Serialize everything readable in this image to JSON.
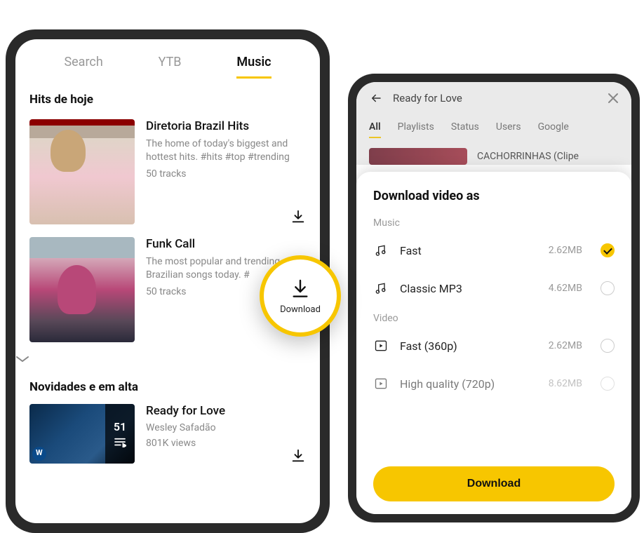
{
  "phone1": {
    "tabs": {
      "search": "Search",
      "ytb": "YTB",
      "music": "Music"
    },
    "section1_title": "Hits de hoje",
    "items": [
      {
        "title": "Diretoria Brazil Hits",
        "desc": "The home of today's biggest and hottest hits. #hits #top #trending",
        "meta": "50 tracks"
      },
      {
        "title": "Funk Call",
        "desc": "The most popular and trending Brazilian songs today. #",
        "meta": "50 tracks"
      }
    ],
    "section2_title": "Novidades e em alta",
    "item3": {
      "title": "Ready for Love",
      "artist": "Wesley Safadão",
      "views": "801K views",
      "badge_count": "51"
    }
  },
  "callout": {
    "label": "Download"
  },
  "phone2": {
    "search_query": "Ready for Love",
    "filters": {
      "all": "All",
      "playlists": "Playlists",
      "status": "Status",
      "users": "Users",
      "google": "Google"
    },
    "result_title": "CACHORRINHAS (Clipe",
    "sheet": {
      "title": "Download video as",
      "group_music": "Music",
      "group_video": "Video",
      "options": {
        "fast_audio": {
          "label": "Fast",
          "size": "2.62MB"
        },
        "classic_mp3": {
          "label": "Classic MP3",
          "size": "4.62MB"
        },
        "fast_video": {
          "label": "Fast (360p)",
          "size": "2.62MB"
        },
        "hq_video": {
          "label": "High quality (720p)",
          "size": "8.62MB"
        }
      },
      "button": "Download"
    }
  }
}
